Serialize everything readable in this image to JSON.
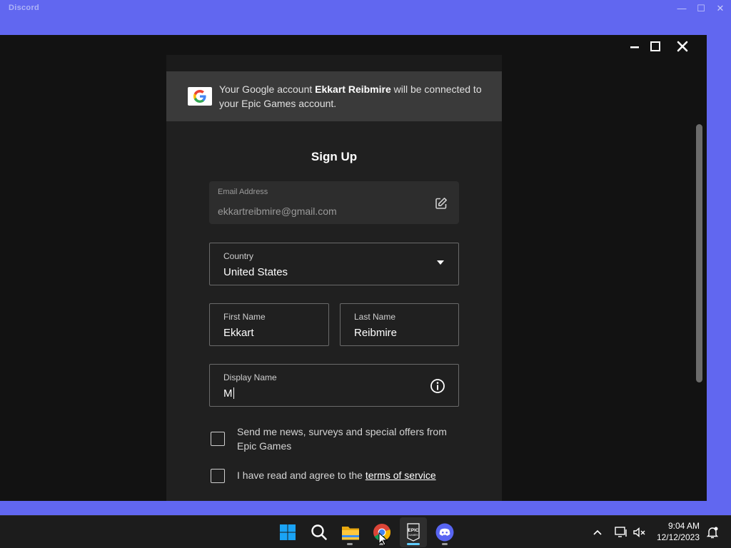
{
  "discord": {
    "title": "Discord",
    "controls": {
      "minimize": "—",
      "maximize": "☐",
      "close": "✕"
    }
  },
  "epic": {
    "google_banner": {
      "prefix": "Your Google account ",
      "account_name": "Ekkart Reibmire",
      "suffix": " will be connected to your Epic Games account."
    },
    "signup_title": "Sign Up",
    "email": {
      "label": "Email Address",
      "value": "ekkartreibmire@gmail.com"
    },
    "country": {
      "label": "Country",
      "value": "United States"
    },
    "first_name": {
      "label": "First Name",
      "value": "Ekkart"
    },
    "last_name": {
      "label": "Last Name",
      "value": "Reibmire"
    },
    "display_name": {
      "label": "Display Name",
      "value": "M"
    },
    "news_checkbox": {
      "label": "Send me news, surveys and special offers from Epic Games",
      "checked": false
    },
    "tos_checkbox": {
      "prefix": "I have read and agree to the ",
      "link": "terms of service",
      "checked": false
    }
  },
  "taskbar": {
    "time": "9:04 AM",
    "date": "12/12/2023",
    "apps": [
      "start-icon",
      "search-icon",
      "file-explorer-icon",
      "chrome-icon",
      "epic-games-icon",
      "discord-icon"
    ]
  },
  "colors": {
    "discord_brand": "#5865f2",
    "epic_bg": "#121212",
    "panel_bg": "#202020",
    "taskbar_bg": "#1c1c1c",
    "accent_indicator": "#60cdff"
  }
}
